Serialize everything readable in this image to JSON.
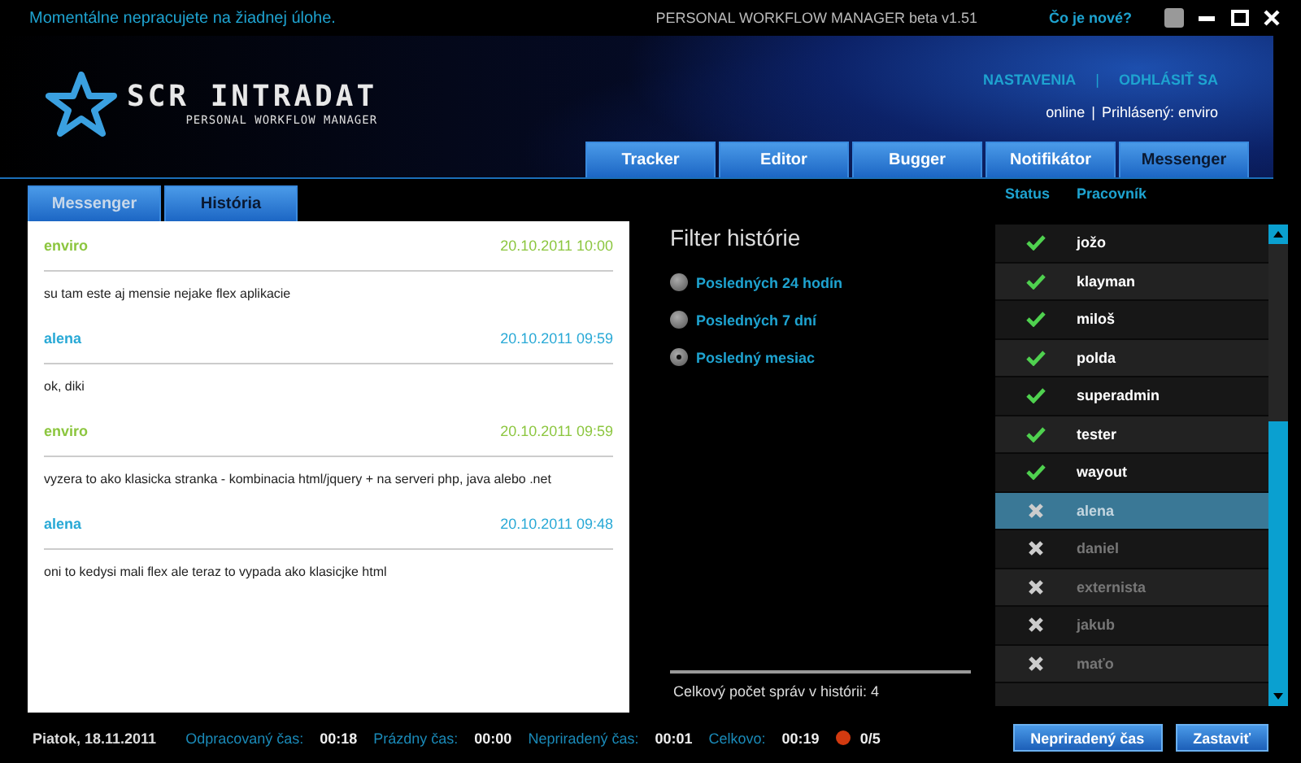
{
  "top_bar": {
    "status_message": "Momentálne nepracujete na žiadnej úlohe.",
    "app_title": "PERSONAL WORKFLOW MANAGER beta v1.51",
    "whats_new": "Čo je nové?"
  },
  "header": {
    "logo_title": "SCR INTRADAT",
    "logo_subtitle": "PERSONAL WORKFLOW MANAGER",
    "links": [
      "NASTAVENIA",
      "ODHLÁSIŤ SA"
    ],
    "link_separator": "|",
    "presence": "online",
    "presence_separator": "|",
    "logged_in": "Prihlásený: enviro"
  },
  "nav_tabs": [
    {
      "label": "Tracker",
      "selected": false
    },
    {
      "label": "Editor",
      "selected": false
    },
    {
      "label": "Bugger",
      "selected": false
    },
    {
      "label": "Notifikátor",
      "selected": false
    },
    {
      "label": "Messenger",
      "selected": true
    }
  ],
  "sub_tabs": [
    {
      "label": "Messenger",
      "selected": false
    },
    {
      "label": "História",
      "selected": true
    }
  ],
  "messages": [
    {
      "author": "enviro",
      "time": "20.10.2011 10:00",
      "color": "#8cc63f",
      "text": "su tam este aj mensie nejake flex aplikacie"
    },
    {
      "author": "alena",
      "time": "20.10.2011 09:59",
      "color": "#29a9d6",
      "text": "ok, diki"
    },
    {
      "author": "enviro",
      "time": "20.10.2011 09:59",
      "color": "#8cc63f",
      "text": "vyzera to ako klasicka stranka - kombinacia html/jquery + na serveri php, java alebo .net"
    },
    {
      "author": "alena",
      "time": "20.10.2011 09:48",
      "color": "#29a9d6",
      "text": "oni to kedysi mali flex ale teraz to vypada ako klasicjke html"
    }
  ],
  "filter": {
    "title": "Filter histórie",
    "options": [
      {
        "label": "Posledných 24 hodín",
        "selected": false
      },
      {
        "label": "Posledných 7 dní",
        "selected": false
      },
      {
        "label": "Posledný mesiac",
        "selected": true
      }
    ],
    "total": "Celkový počet správ v histórii: 4"
  },
  "users": {
    "columns": [
      "Status",
      "Pracovník"
    ],
    "rows": [
      {
        "name": "jožo",
        "online": true,
        "selected": false
      },
      {
        "name": "klayman",
        "online": true,
        "selected": false
      },
      {
        "name": "miloš",
        "online": true,
        "selected": false
      },
      {
        "name": "polda",
        "online": true,
        "selected": false
      },
      {
        "name": "superadmin",
        "online": true,
        "selected": false
      },
      {
        "name": "tester",
        "online": true,
        "selected": false
      },
      {
        "name": "wayout",
        "online": true,
        "selected": false
      },
      {
        "name": "alena",
        "online": false,
        "selected": true
      },
      {
        "name": "daniel",
        "online": false,
        "selected": false
      },
      {
        "name": "externista",
        "online": false,
        "selected": false
      },
      {
        "name": "jakub",
        "online": false,
        "selected": false
      },
      {
        "name": "maťo",
        "online": false,
        "selected": false
      }
    ]
  },
  "status_bar": {
    "date": "Piatok, 18.11.2011",
    "stats": [
      {
        "label": "Odpracovaný čas:",
        "value": "00:18"
      },
      {
        "label": "Prázdny čas:",
        "value": "00:00"
      },
      {
        "label": "Nepriradený čas:",
        "value": "00:01"
      },
      {
        "label": "Celkovo:",
        "value": "00:19"
      }
    ],
    "tomatoes": "0/5",
    "buttons": [
      "Nepriradený čas",
      "Zastaviť"
    ]
  }
}
